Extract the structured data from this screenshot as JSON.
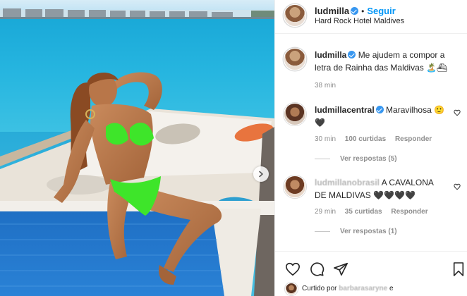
{
  "post": {
    "username": "ludmilla",
    "follow_label": "Seguir",
    "location": "Hard Rock Hotel Maldives",
    "caption_username": "ludmilla",
    "caption_line1": "Me ajudem a compor a",
    "caption_line2": "letra de Rainha das Maldivas",
    "caption_emojis": "🏝️⛴",
    "caption_time": "38 min"
  },
  "comments": [
    {
      "username": "ludmillacentral",
      "text": "Maravilhosa",
      "emoji1": "🙂",
      "emoji2": "🖤",
      "time": "30 min",
      "likes": "100 curtidas",
      "reply_label": "Responder",
      "view_replies": "Ver respostas (5)"
    },
    {
      "username": "ludmillanobrasil",
      "text_line1": "A CAVALONA",
      "text_line2": "DE MALDIVAS",
      "hearts": "🖤🖤🖤🖤",
      "time": "29 min",
      "likes": "35 curtidas",
      "reply_label": "Responder",
      "view_replies": "Ver respostas (1)"
    }
  ],
  "footer": {
    "liked_by_prefix": "Curtido por",
    "liked_by_user": "barbarasaryne",
    "liked_by_suffix": "e"
  },
  "icons": {
    "like": "heart-icon",
    "comment": "comment-icon",
    "share": "share-icon",
    "save": "bookmark-icon",
    "next": "chevron-right-icon"
  },
  "colors": {
    "link_blue": "#0095f6",
    "verified_blue": "#3897f0",
    "meta_gray": "#8e8e8e",
    "bikini_green": "#3ee52a"
  }
}
